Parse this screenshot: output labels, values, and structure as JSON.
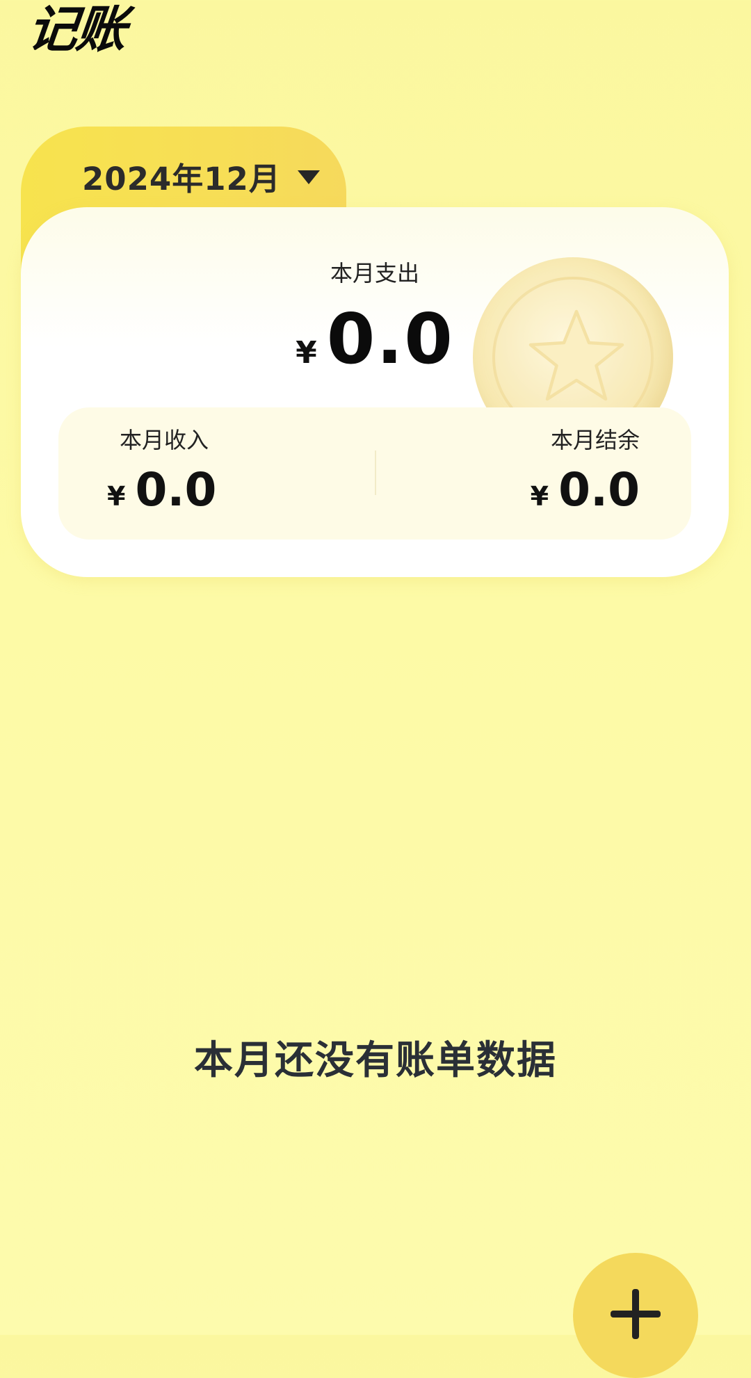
{
  "app": {
    "title": "记账"
  },
  "month_selector": {
    "label": "2024年12月",
    "icon": "caret-down-icon"
  },
  "summary": {
    "expense": {
      "label": "本月支出",
      "currency": "¥",
      "amount": "0.0"
    },
    "income": {
      "label": "本月收入",
      "currency": "¥",
      "amount": "0.0"
    },
    "balance": {
      "label": "本月结余",
      "currency": "¥",
      "amount": "0.0"
    },
    "decoration_icon": "star-coin-icon"
  },
  "empty_state": {
    "message": "本月还没有账单数据"
  },
  "fab": {
    "icon": "plus-icon"
  },
  "colors": {
    "background": "#fbf79f",
    "accent": "#f7e34e",
    "fab": "#f4d95c",
    "card": "#ffffff"
  }
}
